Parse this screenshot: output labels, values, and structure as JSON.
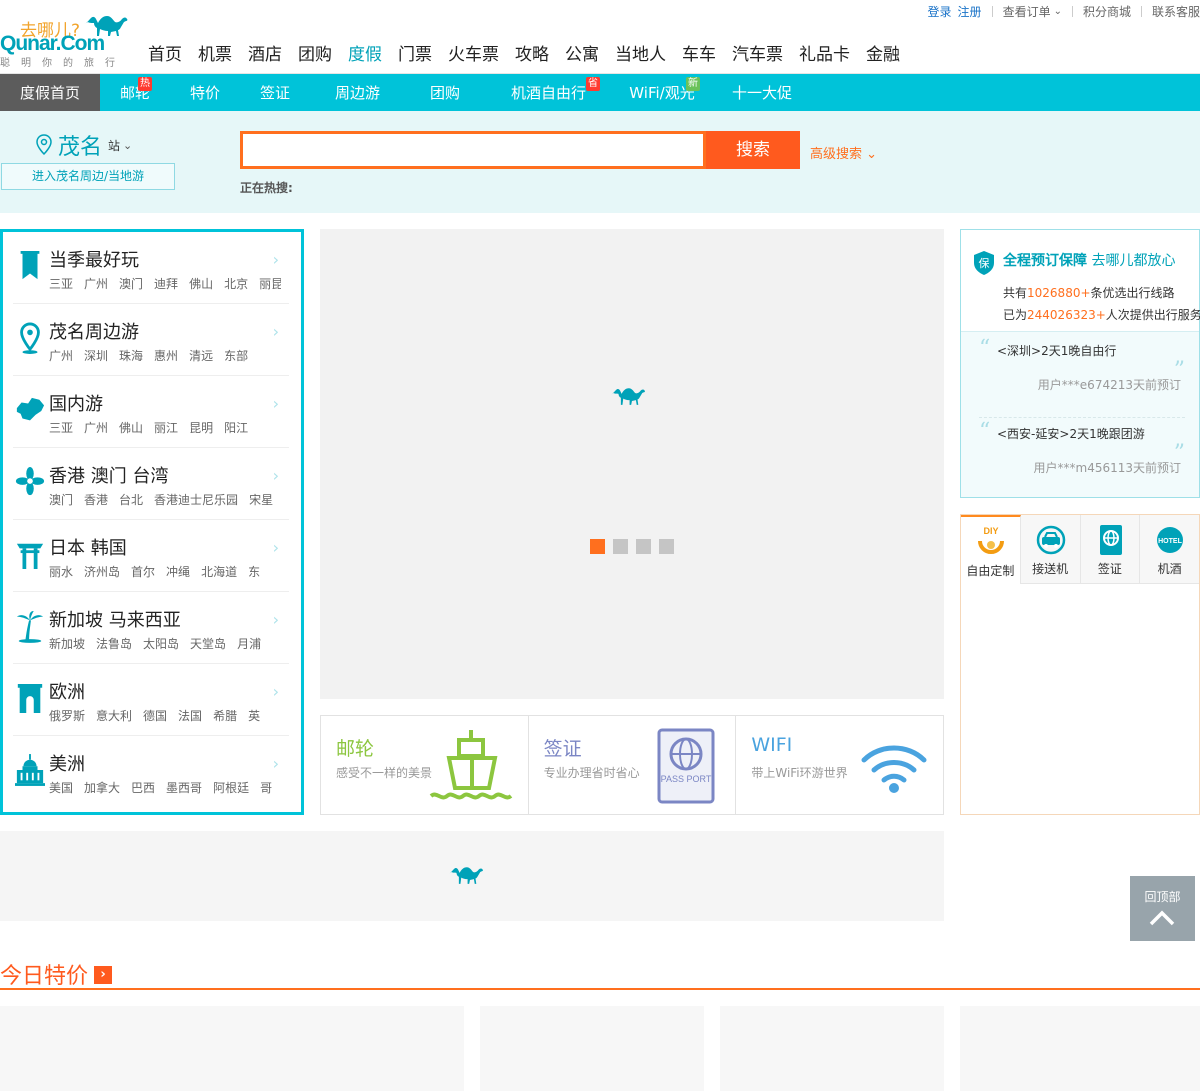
{
  "header": {
    "logo": {
      "cn": "去哪儿?",
      "en": "Qunar.Com",
      "slogan": "聪明你的旅行"
    },
    "top_links": {
      "login": "登录",
      "register": "注册",
      "orders": "查看订单",
      "orders_caret": "⌄",
      "points_mall": "积分商城",
      "contact": "联系客服"
    },
    "main_nav": [
      "首页",
      "机票",
      "酒店",
      "团购",
      "度假",
      "门票",
      "火车票",
      "攻略",
      "公寓",
      "当地人",
      "车车",
      "汽车票",
      "礼品卡",
      "金融"
    ],
    "active_nav": "度假"
  },
  "sub_nav": {
    "items": [
      {
        "label": "度假首页"
      },
      {
        "label": "邮轮",
        "badge": "热"
      },
      {
        "label": "特价"
      },
      {
        "label": "签证"
      },
      {
        "label": "周边游"
      },
      {
        "label": "团购"
      },
      {
        "label": "机酒自由行",
        "badge": "省"
      },
      {
        "label": "WiFi/观光",
        "badge": "新"
      },
      {
        "label": "十一大促"
      }
    ]
  },
  "search": {
    "city": "茂名",
    "city_suffix": "站",
    "city_caret": "⌄",
    "nearby_link": "进入茂名周边/当地游",
    "query": "",
    "button": "搜索",
    "advanced": "高级搜索",
    "advanced_caret": "⌄",
    "hot_label": "正在热搜:"
  },
  "categories": [
    {
      "title": "当季最好玩",
      "icon": "bookmark-icon",
      "subs": [
        "三亚",
        "广州",
        "澳门",
        "迪拜",
        "佛山",
        "北京",
        "丽昆"
      ]
    },
    {
      "title": "茂名周边游",
      "icon": "location-pin-icon",
      "subs": [
        "广州",
        "深圳",
        "珠海",
        "惠州",
        "清远",
        "东部"
      ]
    },
    {
      "title": "国内游",
      "icon": "china-map-icon",
      "subs": [
        "三亚",
        "广州",
        "佛山",
        "丽江",
        "昆明",
        "阳江"
      ]
    },
    {
      "title": "香港 澳门 台湾",
      "icon": "bauhinia-icon",
      "subs": [
        "澳门",
        "香港",
        "台北",
        "香港迪士尼乐园",
        "宋星"
      ]
    },
    {
      "title": "日本 韩国",
      "icon": "japan-gate-icon",
      "subs": [
        "丽水",
        "济州岛",
        "首尔",
        "冲绳",
        "北海道",
        "东"
      ]
    },
    {
      "title": "新加坡 马来西亚",
      "icon": "palm-tree-icon",
      "subs": [
        "新加坡",
        "法鲁岛",
        "太阳岛",
        "天堂岛",
        "月浦"
      ]
    },
    {
      "title": "欧洲",
      "icon": "arc-de-triomphe-icon",
      "subs": [
        "俄罗斯",
        "意大利",
        "德国",
        "法国",
        "希腊",
        "英"
      ]
    },
    {
      "title": "美洲",
      "icon": "capitol-icon",
      "subs": [
        "美国",
        "加拿大",
        "巴西",
        "墨西哥",
        "阿根廷",
        "哥"
      ]
    }
  ],
  "banner": {
    "slides_total": 4,
    "active_slide": 1
  },
  "features": [
    {
      "title": "邮轮",
      "desc": "感受不一样的美景",
      "color": "#8cc63f",
      "icon": "cruise-ship-icon"
    },
    {
      "title": "签证",
      "desc": "专业办理省时省心",
      "color": "#7b86c4",
      "icon": "passport-icon",
      "icon_text": "PASS PORT"
    },
    {
      "title": "WIFI",
      "desc": "带上WiFi环游世界",
      "color": "#4aa3df",
      "icon": "wifi-icon"
    }
  ],
  "guarantee": {
    "title": "全程预订保障",
    "subtitle": "去哪儿都放心",
    "shield_char": "保",
    "line1": {
      "pre": "共有",
      "num": "1026880+",
      "post": "条优选出行线路"
    },
    "line2": {
      "pre": "已为",
      "num": "244026323+",
      "post": "人次提供出行服务"
    }
  },
  "reviews": [
    {
      "text": "<深圳>2天1晚自由行",
      "user": "用户***e674213天前预订"
    },
    {
      "text": "<西安-延安>2天1晚跟团游",
      "user": "用户***m456113天前预订"
    }
  ],
  "services": [
    {
      "label": "自由定制",
      "icon": "diy-icon",
      "icon_text": "DIY"
    },
    {
      "label": "接送机",
      "icon": "airport-car-icon"
    },
    {
      "label": "签证",
      "icon": "visa-globe-icon"
    },
    {
      "label": "机酒",
      "icon": "hotel-icon",
      "icon_text": "HOTEL"
    }
  ],
  "back_to_top": "回顶部",
  "today_deals": {
    "title": "今日特价",
    "arrow": "›"
  },
  "colors": {
    "brand": "#00c3d9",
    "accent": "#ff5a1e",
    "teal": "#00a2b8"
  }
}
